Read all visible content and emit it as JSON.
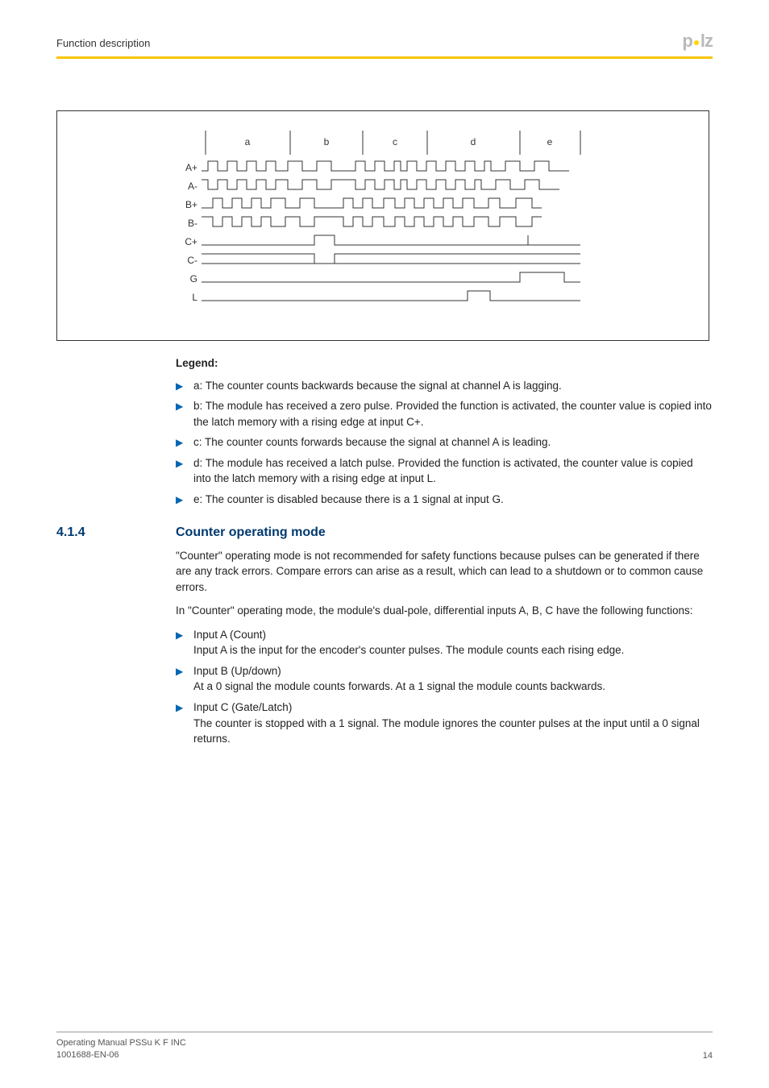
{
  "header": {
    "title": "Function description"
  },
  "logo": {
    "text_before_dot": "p",
    "text_after_dot": "lz"
  },
  "diagram": {
    "col_labels": [
      "a",
      "b",
      "c",
      "d",
      "e"
    ],
    "row_labels": [
      "A+",
      "A-",
      "B+",
      "B-",
      "C+",
      "C-",
      "G",
      "L"
    ]
  },
  "legend": {
    "heading": "Legend:",
    "items": [
      "a: The counter counts backwards because the signal at channel A is lagging.",
      "b: The module has received a zero pulse. Provided the function is activated, the counter value is copied into the latch memory with a rising edge at input C+.",
      "c: The counter counts forwards because the signal at channel A is leading.",
      "d: The module has received a latch pulse. Provided the function is activated, the counter value is copied into the latch memory with a rising edge at input L.",
      "e: The counter is disabled because there is a 1 signal at input G."
    ]
  },
  "section": {
    "num": "4.1.4",
    "title": "Counter operating mode",
    "p1": "\"Counter\" operating mode is not recommended for safety functions because pulses can be generated if there are any track errors. Compare errors can arise as a result, which can lead to a shutdown or to common cause errors.",
    "p2": "In \"Counter\" operating mode, the module's dual-pole, differential inputs A, B, C have the following functions:",
    "items": [
      {
        "head": "Input A (Count)",
        "body": "Input A is the input for the encoder's counter pulses. The module counts each rising edge."
      },
      {
        "head": "Input B (Up/down)",
        "body": "At a 0 signal the module counts forwards. At a 1 signal the module counts backwards."
      },
      {
        "head": "Input C (Gate/Latch)",
        "body": "The counter is stopped with a 1 signal. The module ignores the counter pulses at the input until a 0 signal returns."
      }
    ]
  },
  "footer": {
    "line1": "Operating Manual PSSu K F INC",
    "line2": "1001688-EN-06",
    "page": "14"
  }
}
